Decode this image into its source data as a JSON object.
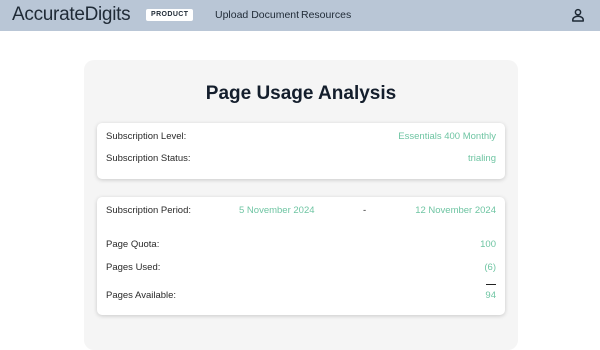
{
  "header": {
    "logo_text": "AccurateDigits",
    "badge": "PRODUCT",
    "nav": [
      "Upload Document",
      "Resources"
    ],
    "user_icon": "user-icon",
    "background": "#b9c6d6"
  },
  "main": {
    "title": "Page Usage Analysis",
    "subscription": {
      "level_label": "Subscription Level:",
      "level_value": "Essentials 400 Monthly",
      "status_label": "Subscription Status:",
      "status_value": "trialing"
    },
    "period": {
      "label": "Subscription Period:",
      "start": "5 November 2024",
      "separator": "-",
      "end": "12 November 2024"
    },
    "usage": {
      "quota_label": "Page Quota:",
      "quota_value": "100",
      "used_label": "Pages Used:",
      "used_value": "(6)",
      "available_label": "Pages Available:",
      "available_value": "94"
    },
    "accent_color": "#6fc5a3"
  }
}
